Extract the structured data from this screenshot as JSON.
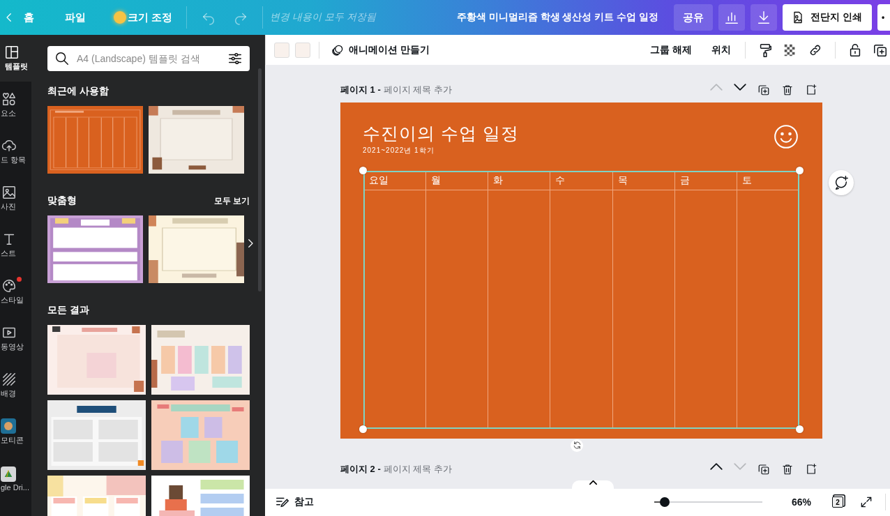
{
  "topbar": {
    "home": "홈",
    "menu": [
      "파일"
    ],
    "resize": "크기 조정",
    "save_status": "변경 내용이 모두 저장됨",
    "doc_title": "주황색 미니멀리즘 학생 생산성 키트 수업 일정",
    "share": "공유",
    "print": "전단지 인쇄",
    "more": "•"
  },
  "rail": [
    {
      "kind": "template",
      "label": "템플릿",
      "selected": true,
      "badge": false
    },
    {
      "kind": "elements",
      "label": "요소",
      "selected": false,
      "badge": false
    },
    {
      "kind": "upload",
      "label": "드 항목",
      "selected": false,
      "badge": false
    },
    {
      "label": "사진",
      "selected": false,
      "badge": false
    },
    {
      "kind": "text",
      "label": "스트",
      "selected": false,
      "badge": false
    },
    {
      "kind": "style",
      "label": "스타일",
      "selected": false,
      "badge": true
    },
    {
      "kind": "video",
      "label": "동영상",
      "selected": false,
      "badge": false
    },
    {
      "kind": "background",
      "label": "배경",
      "selected": false,
      "badge": false
    },
    {
      "kind": "emoji",
      "label": "모티콘",
      "selected": false,
      "badge": false
    },
    {
      "kind": "drive",
      "label": "gle Dri...",
      "selected": false,
      "badge": false
    }
  ],
  "panel": {
    "search": {
      "placeholder": "A4 (Landscape) 템플릿 검색"
    },
    "sections": [
      {
        "title": "최근에 사용함"
      },
      {
        "title": "맞춤형",
        "link": "모두 보기"
      },
      {
        "title": "모든 결과"
      }
    ]
  },
  "toolbar": {
    "swatches": [
      {
        "color": "#f9f1ec"
      },
      {
        "color": "#f9f1ec"
      }
    ],
    "animate": "애니메이션 만들기",
    "actions": [
      "그룹 해제",
      "위치"
    ]
  },
  "pages": [
    {
      "label": "페이지 1 -",
      "title_placeholder": "페이지 제목 추가",
      "up_disabled": true,
      "down_disabled": false
    },
    {
      "label": "페이지 2 -",
      "title_placeholder": "페이지 제목 추가",
      "up_disabled": false,
      "down_disabled": true
    }
  ],
  "design": {
    "title": "수진이의 수업 일정",
    "subtitle": "2021~2022년 1학기",
    "columns": [
      "요일",
      "월",
      "화",
      "수",
      "목",
      "금",
      "토"
    ],
    "table_selected": true
  },
  "bottom": {
    "notes": "참고",
    "zoom": {
      "level": 0.1
    },
    "zoom_reading": "66%",
    "page_count": "2"
  }
}
